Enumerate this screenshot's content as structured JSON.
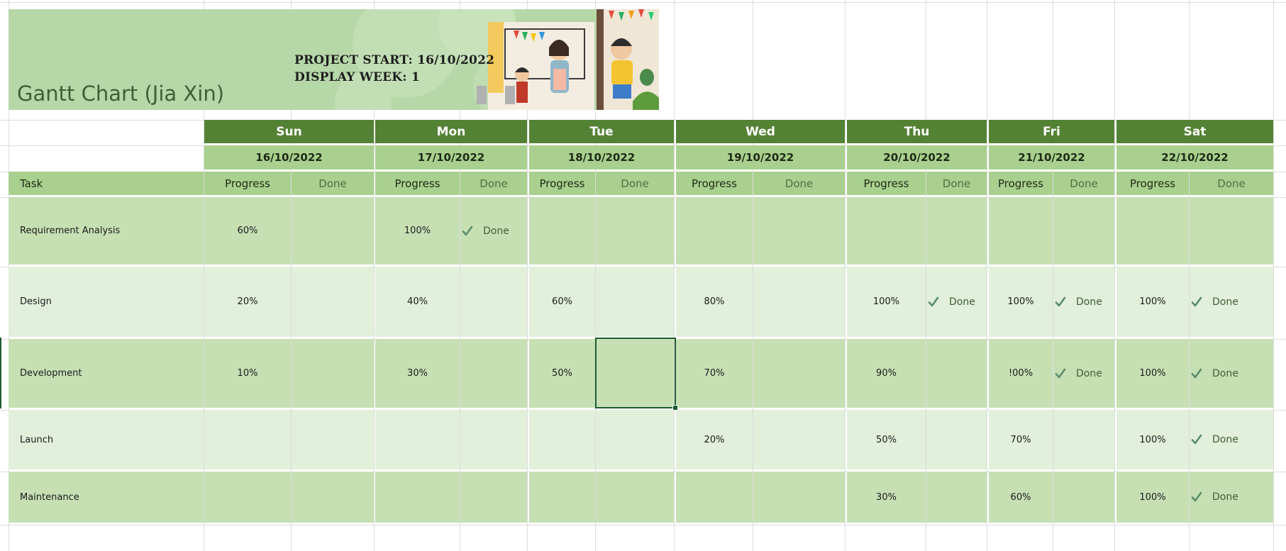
{
  "banner": {
    "title": "Gantt Chart (Jia Xin)",
    "project_start": "PROJECT START: 16/10/2022",
    "display_week": "DISPLAY WEEK: 1"
  },
  "header": {
    "task_label": "Task",
    "progress_label": "Progress",
    "done_label": "Done"
  },
  "days": [
    {
      "name": "Sun",
      "date": "16/10/2022"
    },
    {
      "name": "Mon",
      "date": "17/10/2022"
    },
    {
      "name": "Tue",
      "date": "18/10/2022"
    },
    {
      "name": "Wed",
      "date": "19/10/2022"
    },
    {
      "name": "Thu",
      "date": "20/10/2022"
    },
    {
      "name": "Fri",
      "date": "21/10/2022"
    },
    {
      "name": "Sat",
      "date": "22/10/2022"
    }
  ],
  "tasks": [
    {
      "name": "Requirement Analysis",
      "cells": [
        [
          "60%",
          ""
        ],
        [
          "100%",
          "Done"
        ],
        [
          "",
          ""
        ],
        [
          "",
          ""
        ],
        [
          "",
          ""
        ],
        [
          "",
          ""
        ],
        [
          "",
          ""
        ]
      ]
    },
    {
      "name": "Design",
      "cells": [
        [
          "20%",
          ""
        ],
        [
          "40%",
          ""
        ],
        [
          "60%",
          ""
        ],
        [
          "80%",
          ""
        ],
        [
          "100%",
          "Done"
        ],
        [
          "100%",
          "Done"
        ],
        [
          "100%",
          "Done"
        ]
      ]
    },
    {
      "name": "Development",
      "cells": [
        [
          "10%",
          ""
        ],
        [
          "30%",
          ""
        ],
        [
          "50%",
          ""
        ],
        [
          "70%",
          ""
        ],
        [
          "90%",
          ""
        ],
        [
          "!00%",
          "Done"
        ],
        [
          "100%",
          "Done"
        ]
      ]
    },
    {
      "name": "Launch",
      "cells": [
        [
          "",
          ""
        ],
        [
          "",
          ""
        ],
        [
          "",
          ""
        ],
        [
          "20%",
          ""
        ],
        [
          "50%",
          ""
        ],
        [
          "70%",
          ""
        ],
        [
          "100%",
          "Done"
        ]
      ]
    },
    {
      "name": "Maintenance",
      "cells": [
        [
          "",
          ""
        ],
        [
          "",
          ""
        ],
        [
          "",
          ""
        ],
        [
          "",
          ""
        ],
        [
          "30%",
          ""
        ],
        [
          "60%",
          ""
        ],
        [
          "100%",
          "Done"
        ]
      ]
    }
  ],
  "colors": {
    "day_header": "#548235",
    "sub_header": "#a9d08e",
    "row_dark": "#c6e0b4",
    "row_light": "#e2efda",
    "banner": "#b6d7a8",
    "check": "#5b8c6a"
  }
}
